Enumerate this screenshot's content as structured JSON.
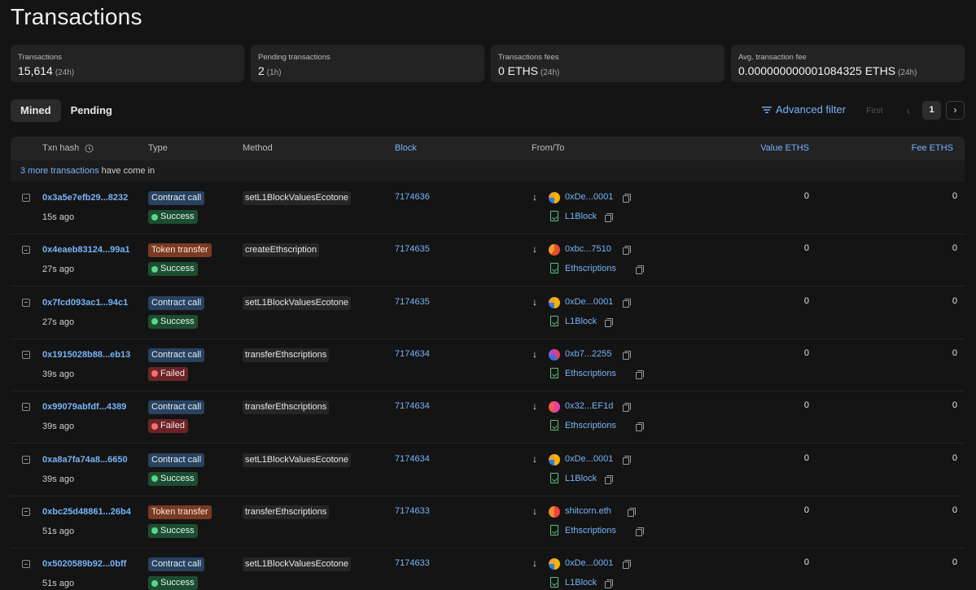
{
  "page_title": "Transactions",
  "stats": [
    {
      "label": "Transactions",
      "value": "15,614",
      "period": "(24h)"
    },
    {
      "label": "Pending transactions",
      "value": "2",
      "period": "(1h)"
    },
    {
      "label": "Transactions fees",
      "value": "0 ETHS",
      "period": "(24h)"
    },
    {
      "label": "Avg. transaction fee",
      "value": "0.000000000001084325 ETHS",
      "period": "(24h)"
    }
  ],
  "tabs": [
    {
      "label": "Mined",
      "active": true
    },
    {
      "label": "Pending",
      "active": false
    }
  ],
  "toolbar": {
    "advanced_filter": "Advanced filter",
    "first": "First",
    "prev": "‹",
    "page": "1",
    "next": "›"
  },
  "table": {
    "headers": {
      "txn_hash": "Txn hash",
      "type": "Type",
      "method": "Method",
      "block": "Block",
      "from_to": "From/To",
      "value": "Value ETHS",
      "fee": "Fee ETHS"
    },
    "notice_link": "3 more transactions",
    "notice_text": " have come in",
    "rows": [
      {
        "hash": "0x3a5e7efb29...8232",
        "age": "15s ago",
        "type": "Contract call",
        "status": "Success",
        "method": "setL1BlockValuesEcotone",
        "block": "7174636",
        "from": "0xDe...0001",
        "to": "L1Block",
        "value": "0",
        "fee": "0"
      },
      {
        "hash": "0x4eaeb83124...99a1",
        "age": "27s ago",
        "type": "Token transfer",
        "status": "Success",
        "method": "createEthscription",
        "block": "7174635",
        "from": "0xbc...7510",
        "to": "Ethscriptions",
        "value": "0",
        "fee": "0"
      },
      {
        "hash": "0x7fcd093ac1...94c1",
        "age": "27s ago",
        "type": "Contract call",
        "status": "Success",
        "method": "setL1BlockValuesEcotone",
        "block": "7174635",
        "from": "0xDe...0001",
        "to": "L1Block",
        "value": "0",
        "fee": "0"
      },
      {
        "hash": "0x1915028b88...eb13",
        "age": "39s ago",
        "type": "Contract call",
        "status": "Failed",
        "method": "transferEthscriptions",
        "block": "7174634",
        "from": "0xb7...2255",
        "to": "Ethscriptions",
        "value": "0",
        "fee": "0"
      },
      {
        "hash": "0x99079abfdf...4389",
        "age": "39s ago",
        "type": "Contract call",
        "status": "Failed",
        "method": "transferEthscriptions",
        "block": "7174634",
        "from": "0x32...EF1d",
        "to": "Ethscriptions",
        "value": "0",
        "fee": "0"
      },
      {
        "hash": "0xa8a7fa74a8...6650",
        "age": "39s ago",
        "type": "Contract call",
        "status": "Success",
        "method": "setL1BlockValuesEcotone",
        "block": "7174634",
        "from": "0xDe...0001",
        "to": "L1Block",
        "value": "0",
        "fee": "0"
      },
      {
        "hash": "0xbc25d48861...26b4",
        "age": "51s ago",
        "type": "Token transfer",
        "status": "Success",
        "method": "transferEthscriptions",
        "block": "7174633",
        "from": "shitcorn.eth",
        "to": "Ethscriptions",
        "value": "0",
        "fee": "0"
      },
      {
        "hash": "0x5020589b92...0bff",
        "age": "51s ago",
        "type": "Contract call",
        "status": "Success",
        "method": "setL1BlockValuesEcotone",
        "block": "7174633",
        "from": "0xDe...0001",
        "to": "L1Block",
        "value": "0",
        "fee": "0"
      }
    ]
  },
  "colors": {
    "link": "#76b4f7",
    "success": "#1d4d30",
    "failed": "#6a2428",
    "contract": "#28425f",
    "token": "#7a3b22"
  },
  "icons": {
    "filter": "filter-lines-icon",
    "expand": "expand-row-icon",
    "direction": "arrow-down-icon",
    "contract": "contract-file-icon",
    "copy": "copy-icon",
    "info": "clock-info-icon"
  }
}
